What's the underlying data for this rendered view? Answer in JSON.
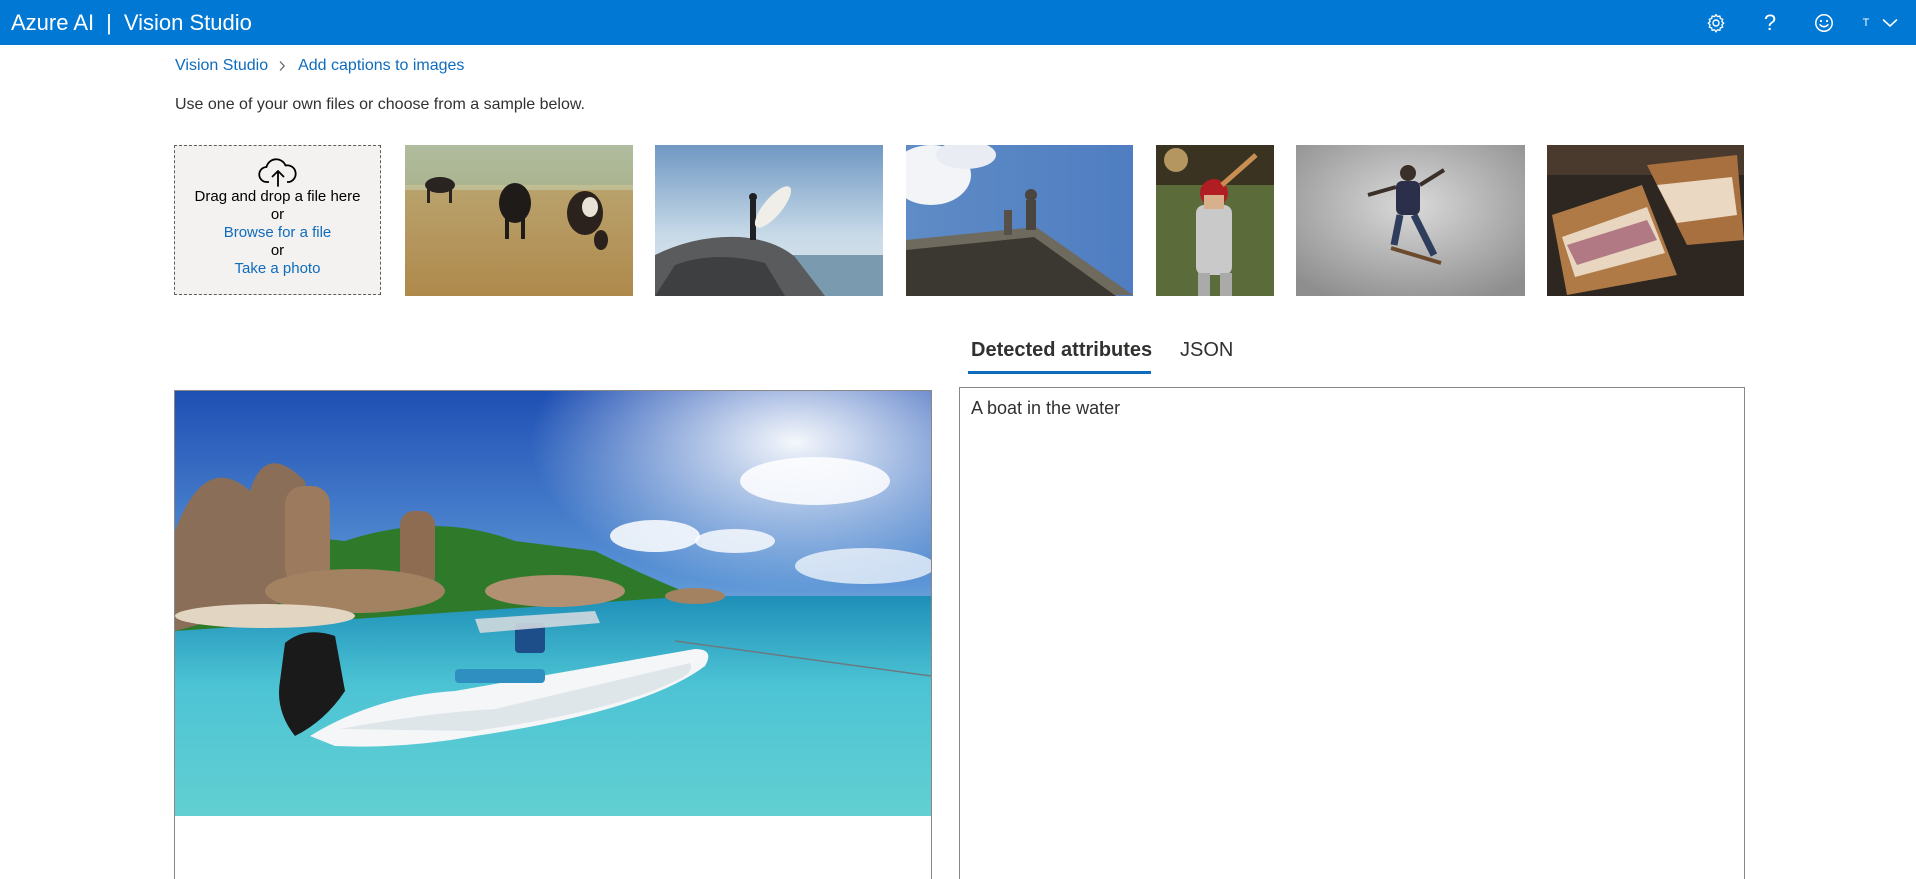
{
  "header": {
    "brand_primary": "Azure AI",
    "brand_separator": "|",
    "brand_secondary": "Vision Studio",
    "help_label": "?",
    "avatar_initial": "T",
    "icons": [
      "gear-icon",
      "help-icon",
      "smiley-icon",
      "chevron-down-icon"
    ]
  },
  "breadcrumb": {
    "items": [
      "Vision Studio",
      "Add captions to images"
    ]
  },
  "intro": "Use one of your own files or choose from a sample below.",
  "upload": {
    "drag_text": "Drag and drop a file here",
    "or_1": "or",
    "browse_label": "Browse for a file",
    "or_2": "or",
    "photo_label": "Take a photo",
    "icon": "cloud-upload-icon"
  },
  "samples": [
    {
      "name": "cows grazing"
    },
    {
      "name": "surfer on rock"
    },
    {
      "name": "statue on building"
    },
    {
      "name": "baseball batter"
    },
    {
      "name": "skateboarder"
    },
    {
      "name": "sandwich"
    }
  ],
  "tabs": {
    "items": [
      "Detected attributes",
      "JSON"
    ],
    "active": "Detected attributes"
  },
  "result": {
    "caption": "A boat in the water"
  },
  "colors": {
    "brand": "#0078d4",
    "link": "#0f6cbd",
    "text": "#323130"
  }
}
